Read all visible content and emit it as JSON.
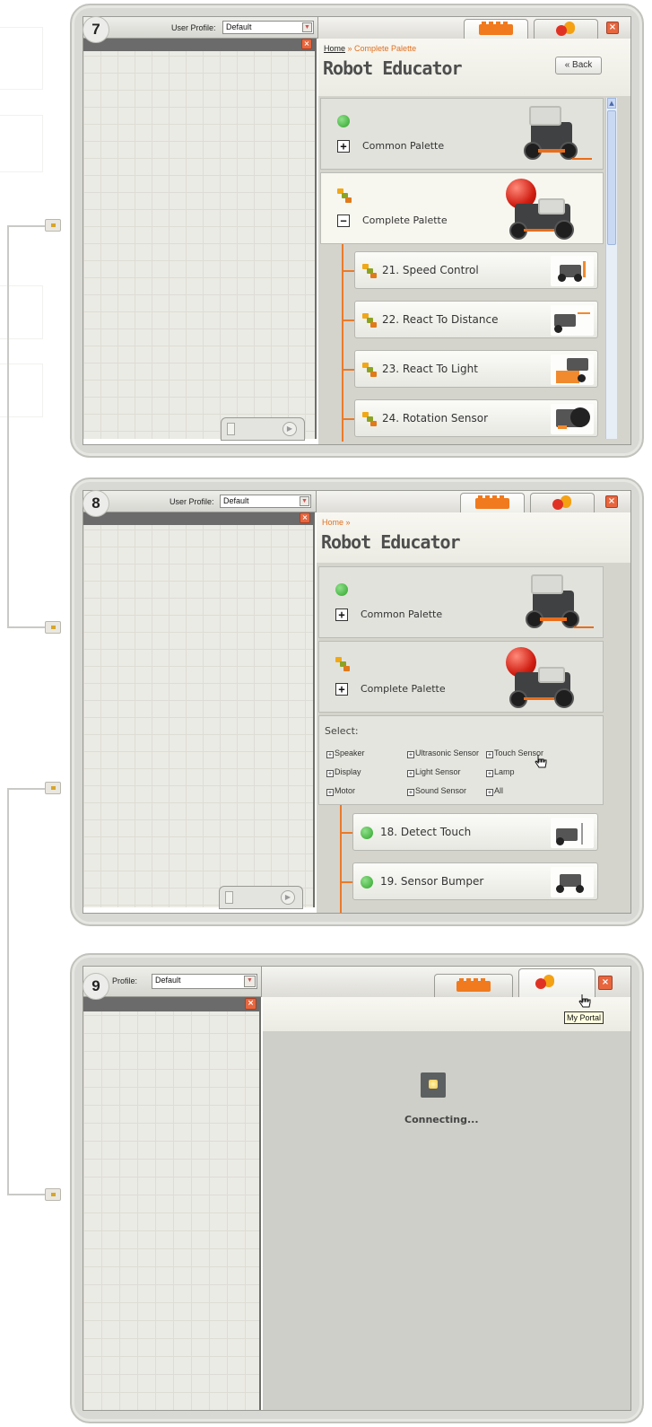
{
  "steps": [
    {
      "number": "7",
      "profile_label": "User Profile:",
      "profile_value": "Default",
      "breadcrumb_home": "Home",
      "breadcrumb_sep": " » ",
      "breadcrumb_current": "Complete Palette",
      "title": "Robot Educator",
      "back_label": "« Back",
      "palettes": [
        {
          "label": "Common Palette",
          "expander": "+"
        },
        {
          "label": "Complete Palette",
          "expander": "−"
        }
      ],
      "lessons": [
        "21. Speed Control",
        "22. React To Distance",
        "23. React To Light",
        "24. Rotation Sensor"
      ]
    },
    {
      "number": "8",
      "profile_label": "User Profile:",
      "profile_value": "Default",
      "breadcrumb_home": "Home »",
      "title": "Robot Educator",
      "palettes": [
        {
          "label": "Common Palette",
          "expander": "+"
        },
        {
          "label": "Complete Palette",
          "expander": "+"
        }
      ],
      "select_title": "Select:",
      "select_options": [
        "Speaker",
        "Ultrasonic Sensor",
        "Touch Sensor",
        "Display",
        "Light Sensor",
        "Lamp",
        "Motor",
        "Sound Sensor",
        "All"
      ],
      "lessons": [
        "18. Detect Touch",
        "19. Sensor Bumper"
      ]
    },
    {
      "number": "9",
      "profile_label": "Profile:",
      "profile_value": "Default",
      "tooltip": "My Portal",
      "status": "Connecting..."
    }
  ],
  "icons": {
    "close": "×",
    "expander_open": "−",
    "expander_closed": "+"
  },
  "colors": {
    "accent_orange": "#f07a1d",
    "green_status": "#2ea42a",
    "close_red": "#e8663e"
  }
}
